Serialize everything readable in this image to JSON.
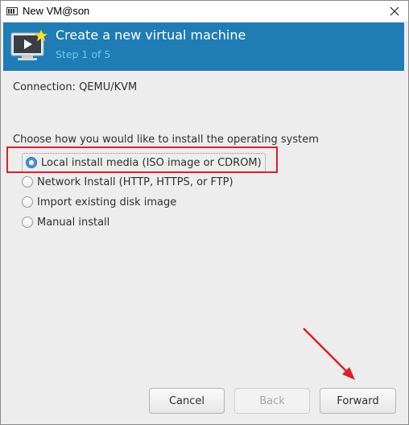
{
  "window": {
    "title": "New VM@son"
  },
  "banner": {
    "title": "Create a new virtual machine",
    "step": "Step 1 of 5"
  },
  "connection": {
    "label": "Connection:",
    "value": "QEMU/KVM"
  },
  "install": {
    "prompt": "Choose how you would like to install the operating system",
    "options": [
      {
        "label": "Local install media (ISO image or CDROM)",
        "selected": true
      },
      {
        "label": "Network Install (HTTP, HTTPS, or FTP)",
        "selected": false
      },
      {
        "label": "Import existing disk image",
        "selected": false
      },
      {
        "label": "Manual install",
        "selected": false
      }
    ]
  },
  "buttons": {
    "cancel": "Cancel",
    "back": "Back",
    "forward": "Forward"
  },
  "colors": {
    "banner": "#1f7cb5",
    "step_text": "#6fc8ee",
    "highlight": "#d9202a",
    "radio_selected": "#4a90d9"
  }
}
